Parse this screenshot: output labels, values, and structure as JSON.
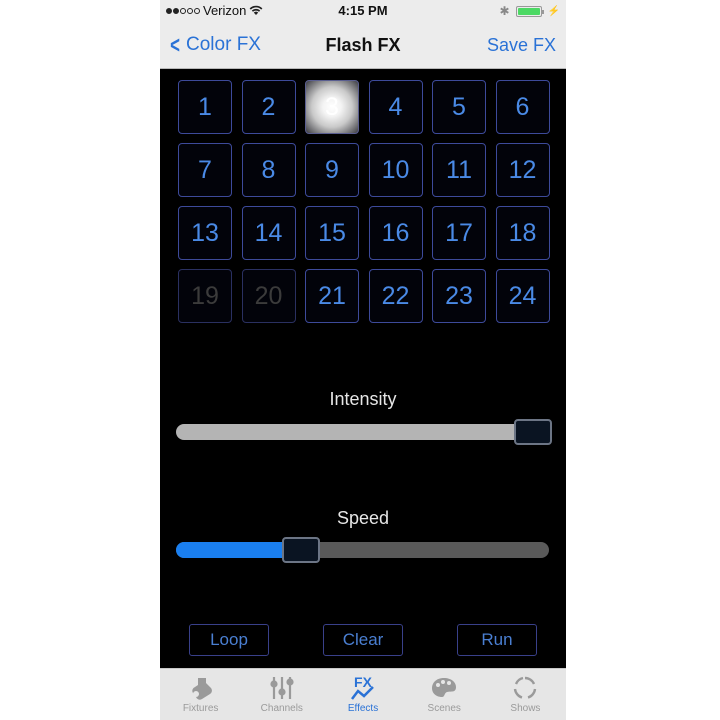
{
  "status_bar": {
    "signal_filled": 2,
    "signal_total": 5,
    "carrier": "Verizon",
    "time": "4:15 PM",
    "battery_percent": 100,
    "battery_color": "#4cd964"
  },
  "nav": {
    "back_label": "Color FX",
    "title": "Flash FX",
    "right_label": "Save FX"
  },
  "grid": {
    "cells": [
      {
        "label": "1",
        "state": "normal"
      },
      {
        "label": "2",
        "state": "normal"
      },
      {
        "label": "3",
        "state": "active"
      },
      {
        "label": "4",
        "state": "normal"
      },
      {
        "label": "5",
        "state": "normal"
      },
      {
        "label": "6",
        "state": "normal"
      },
      {
        "label": "7",
        "state": "normal"
      },
      {
        "label": "8",
        "state": "normal"
      },
      {
        "label": "9",
        "state": "normal"
      },
      {
        "label": "10",
        "state": "normal"
      },
      {
        "label": "11",
        "state": "normal"
      },
      {
        "label": "12",
        "state": "normal"
      },
      {
        "label": "13",
        "state": "normal"
      },
      {
        "label": "14",
        "state": "normal"
      },
      {
        "label": "15",
        "state": "normal"
      },
      {
        "label": "16",
        "state": "normal"
      },
      {
        "label": "17",
        "state": "normal"
      },
      {
        "label": "18",
        "state": "normal"
      },
      {
        "label": "19",
        "state": "disabled"
      },
      {
        "label": "20",
        "state": "disabled"
      },
      {
        "label": "21",
        "state": "normal"
      },
      {
        "label": "22",
        "state": "normal"
      },
      {
        "label": "23",
        "state": "normal"
      },
      {
        "label": "24",
        "state": "normal"
      }
    ]
  },
  "sliders": {
    "intensity": {
      "label": "Intensity",
      "value": 1.0
    },
    "speed": {
      "label": "Speed",
      "value": 0.32,
      "fill_color": "#1a7ff0"
    }
  },
  "buttons": {
    "loop": "Loop",
    "clear": "Clear",
    "run": "Run"
  },
  "tabbar": {
    "accent": "#2a72d6",
    "items": [
      {
        "label": "Fixtures",
        "icon": "fixture-icon",
        "active": false
      },
      {
        "label": "Channels",
        "icon": "channels-icon",
        "active": false
      },
      {
        "label": "Effects",
        "icon": "fx-icon",
        "active": true
      },
      {
        "label": "Scenes",
        "icon": "palette-icon",
        "active": false
      },
      {
        "label": "Shows",
        "icon": "cycle-icon",
        "active": false
      }
    ]
  }
}
